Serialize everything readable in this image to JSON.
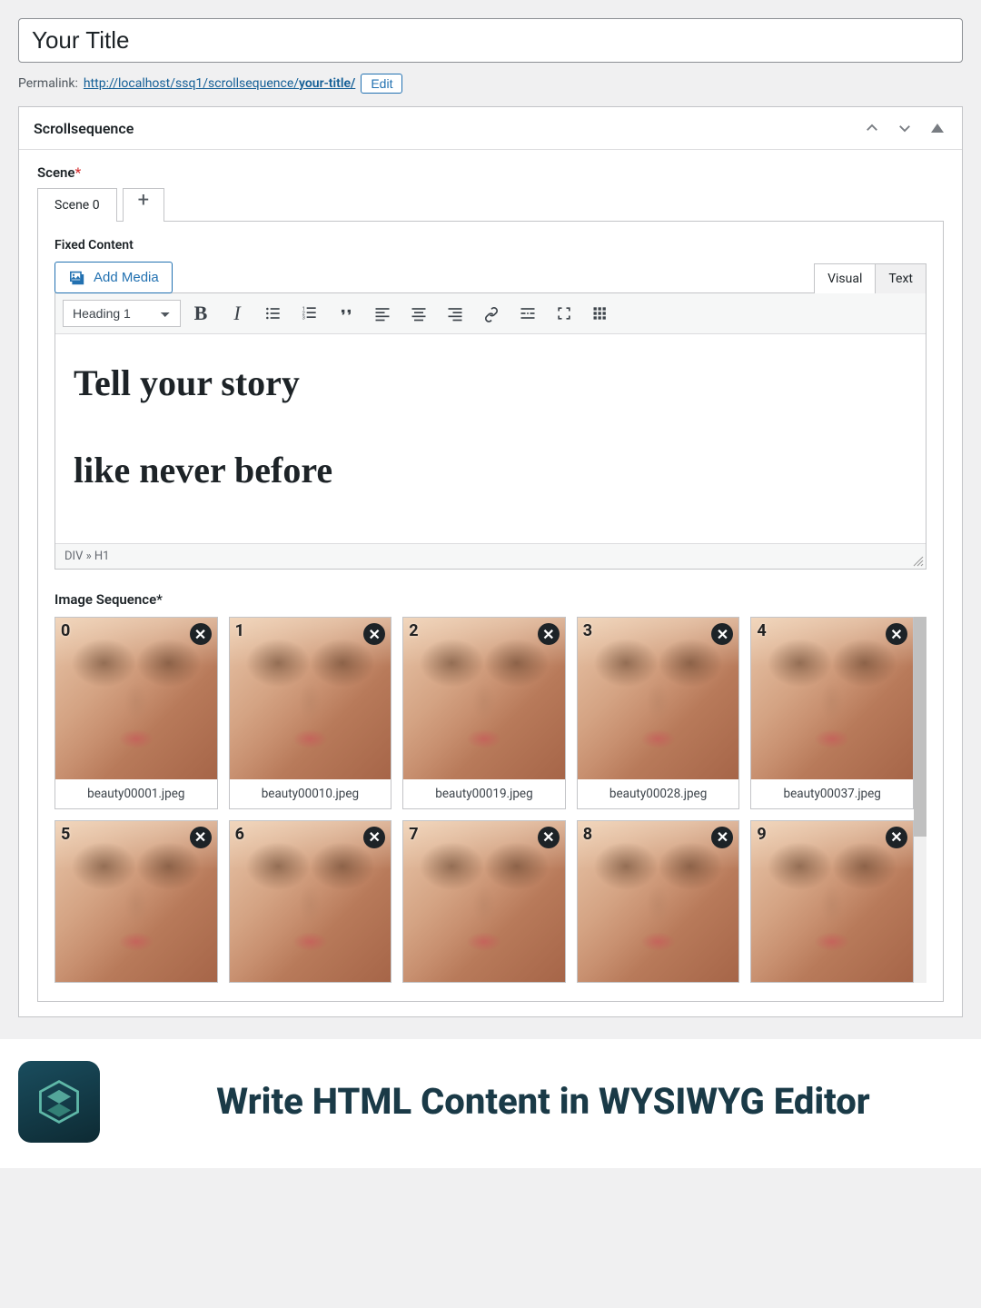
{
  "title_input": {
    "value": "Your Title"
  },
  "permalink": {
    "label": "Permalink:",
    "base": "http://localhost/ssq1/scrollsequence/",
    "slug": "your-title/",
    "edit": "Edit"
  },
  "panel": {
    "title": "Scrollsequence"
  },
  "scene": {
    "label": "Scene",
    "tab0": "Scene 0",
    "add": "+"
  },
  "fixed_content": {
    "label": "Fixed Content",
    "add_media": "Add Media"
  },
  "mode_tabs": {
    "visual": "Visual",
    "text": "Text"
  },
  "toolbar": {
    "format": "Heading 1",
    "bold": "B",
    "italic": "I"
  },
  "editor": {
    "line1": "Tell your story",
    "line2": "like never before",
    "path": "DIV » H1"
  },
  "image_sequence": {
    "label": "Image Sequence",
    "items": [
      {
        "index": "0",
        "filename": "beauty00001.jpeg"
      },
      {
        "index": "1",
        "filename": "beauty00010.jpeg"
      },
      {
        "index": "2",
        "filename": "beauty00019.jpeg"
      },
      {
        "index": "3",
        "filename": "beauty00028.jpeg"
      },
      {
        "index": "4",
        "filename": "beauty00037.jpeg"
      },
      {
        "index": "5",
        "filename": ""
      },
      {
        "index": "6",
        "filename": ""
      },
      {
        "index": "7",
        "filename": ""
      },
      {
        "index": "8",
        "filename": ""
      },
      {
        "index": "9",
        "filename": ""
      }
    ]
  },
  "footer": {
    "text": "Write HTML Content in WYSIWYG Editor"
  }
}
